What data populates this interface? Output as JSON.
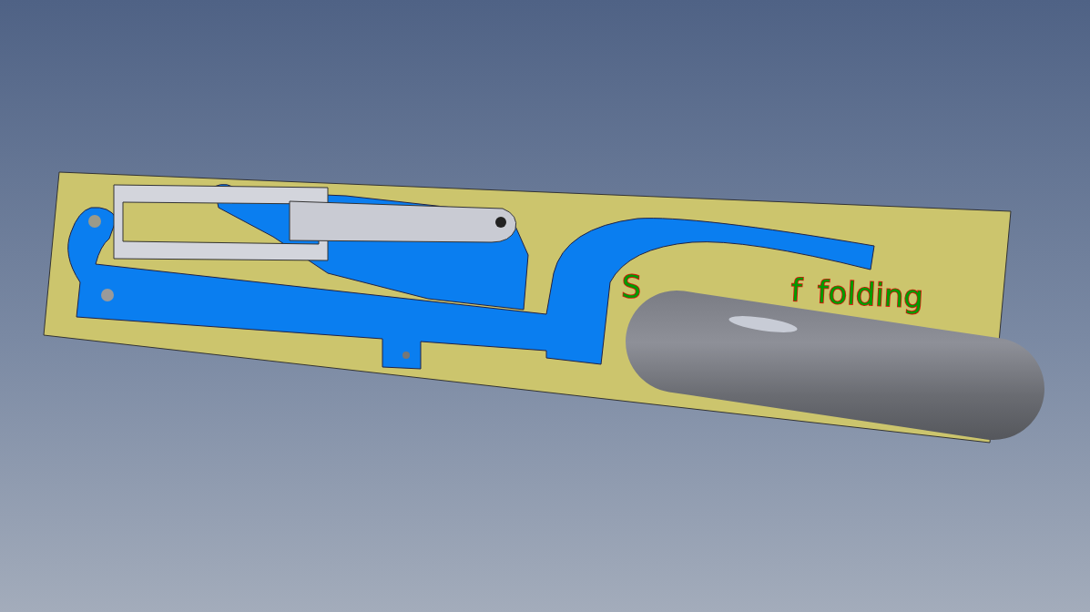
{
  "engraved_text": [
    {
      "text": "S"
    },
    {
      "text": "f"
    },
    {
      "text": "folding"
    }
  ]
}
